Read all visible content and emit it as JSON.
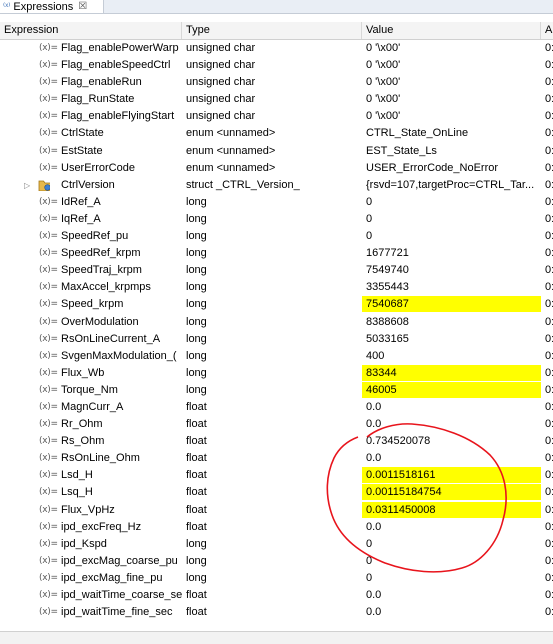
{
  "tab": {
    "icon": "expressions-icon",
    "label": "Expressions",
    "close": "☒"
  },
  "columns": {
    "expression": "Expression",
    "type": "Type",
    "value": "Value",
    "address": "A"
  },
  "rows": [
    {
      "name": "Flag_enablePowerWarp",
      "type": "unsigned char",
      "value": "0 '\\x00'",
      "addr": "0:",
      "hl": false
    },
    {
      "name": "Flag_enableSpeedCtrl",
      "type": "unsigned char",
      "value": "0 '\\x00'",
      "addr": "0:",
      "hl": false
    },
    {
      "name": "Flag_enableRun",
      "type": "unsigned char",
      "value": "0 '\\x00'",
      "addr": "0:",
      "hl": false
    },
    {
      "name": "Flag_RunState",
      "type": "unsigned char",
      "value": "0 '\\x00'",
      "addr": "0:",
      "hl": false
    },
    {
      "name": "Flag_enableFlyingStart",
      "type": "unsigned char",
      "value": "0 '\\x00'",
      "addr": "0:",
      "hl": false
    },
    {
      "name": "CtrlState",
      "type": "enum <unnamed>",
      "value": "CTRL_State_OnLine",
      "addr": "0:",
      "hl": false
    },
    {
      "name": "EstState",
      "type": "enum <unnamed>",
      "value": "EST_State_Ls",
      "addr": "0:",
      "hl": false
    },
    {
      "name": "UserErrorCode",
      "type": "enum <unnamed>",
      "value": "USER_ErrorCode_NoError",
      "addr": "0:",
      "hl": false
    },
    {
      "name": "CtrlVersion",
      "type": "struct _CTRL_Version_",
      "value": "{rsvd=107,targetProc=CTRL_Tar...",
      "addr": "0:",
      "hl": false,
      "struct": true
    },
    {
      "name": "IdRef_A",
      "type": "long",
      "value": "0",
      "addr": "0:",
      "hl": false
    },
    {
      "name": "IqRef_A",
      "type": "long",
      "value": "0",
      "addr": "0:",
      "hl": false
    },
    {
      "name": "SpeedRef_pu",
      "type": "long",
      "value": "0",
      "addr": "0:",
      "hl": false
    },
    {
      "name": "SpeedRef_krpm",
      "type": "long",
      "value": "1677721",
      "addr": "0:",
      "hl": false
    },
    {
      "name": "SpeedTraj_krpm",
      "type": "long",
      "value": "7549740",
      "addr": "0:",
      "hl": false
    },
    {
      "name": "MaxAccel_krpmps",
      "type": "long",
      "value": "3355443",
      "addr": "0:",
      "hl": false
    },
    {
      "name": "Speed_krpm",
      "type": "long",
      "value": "7540687",
      "addr": "0:",
      "hl": true
    },
    {
      "name": "OverModulation",
      "type": "long",
      "value": "8388608",
      "addr": "0:",
      "hl": false
    },
    {
      "name": "RsOnLineCurrent_A",
      "type": "long",
      "value": "5033165",
      "addr": "0:",
      "hl": false
    },
    {
      "name": "SvgenMaxModulation_(",
      "type": "long",
      "value": "400",
      "addr": "0:",
      "hl": false
    },
    {
      "name": "Flux_Wb",
      "type": "long",
      "value": "83344",
      "addr": "0:",
      "hl": true
    },
    {
      "name": "Torque_Nm",
      "type": "long",
      "value": "46005",
      "addr": "0:",
      "hl": true
    },
    {
      "name": "MagnCurr_A",
      "type": "float",
      "value": "0.0",
      "addr": "0:",
      "hl": false
    },
    {
      "name": "Rr_Ohm",
      "type": "float",
      "value": "0.0",
      "addr": "0:",
      "hl": false
    },
    {
      "name": "Rs_Ohm",
      "type": "float",
      "value": "0.734520078",
      "addr": "0:",
      "hl": false
    },
    {
      "name": "RsOnLine_Ohm",
      "type": "float",
      "value": "0.0",
      "addr": "0:",
      "hl": false
    },
    {
      "name": "Lsd_H",
      "type": "float",
      "value": "0.0011518161",
      "addr": "0:",
      "hl": true
    },
    {
      "name": "Lsq_H",
      "type": "float",
      "value": "0.00115184754",
      "addr": "0:",
      "hl": true
    },
    {
      "name": "Flux_VpHz",
      "type": "float",
      "value": "0.0311450008",
      "addr": "0:",
      "hl": true
    },
    {
      "name": "ipd_excFreq_Hz",
      "type": "float",
      "value": "0.0",
      "addr": "0:",
      "hl": false
    },
    {
      "name": "ipd_Kspd",
      "type": "long",
      "value": "0",
      "addr": "0:",
      "hl": false
    },
    {
      "name": "ipd_excMag_coarse_pu",
      "type": "long",
      "value": "0",
      "addr": "0:",
      "hl": false
    },
    {
      "name": "ipd_excMag_fine_pu",
      "type": "long",
      "value": "0",
      "addr": "0:",
      "hl": false
    },
    {
      "name": "ipd_waitTime_coarse_se",
      "type": "float",
      "value": "0.0",
      "addr": "0:",
      "hl": false
    },
    {
      "name": "ipd_waitTime_fine_sec",
      "type": "float",
      "value": "0.0",
      "addr": "0:",
      "hl": false
    }
  ],
  "row_icon": "variable-icon",
  "row_icon_glyph": "(x)=",
  "expander_glyph": "▷",
  "colors": {
    "highlight": "#ffff00",
    "annotation": "#e8141c"
  }
}
